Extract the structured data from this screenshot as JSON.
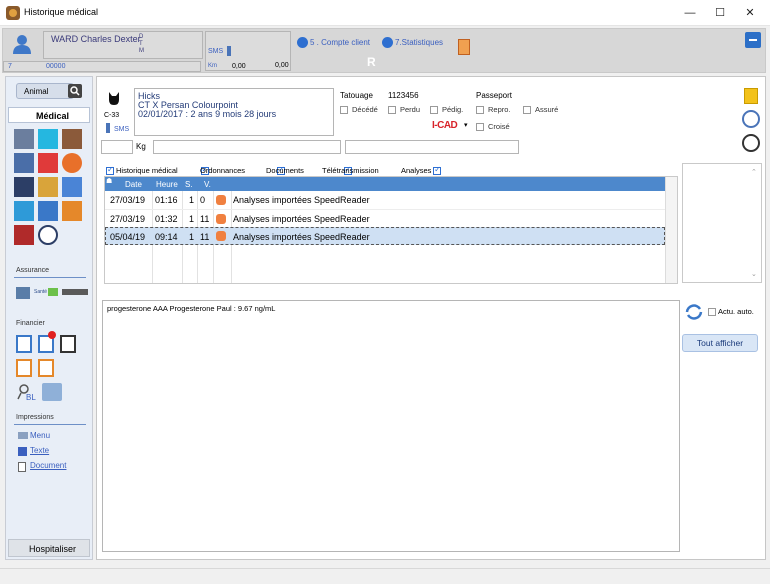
{
  "window": {
    "title": "Historique médical",
    "minimize": "—",
    "maximize": "☐",
    "close": "✕"
  },
  "client": {
    "name": "WARD Charles Dexter",
    "code": "7",
    "number": "00000",
    "flags": [
      "D",
      "T",
      "M"
    ],
    "sms_label": "SMS",
    "km_label": "Km",
    "km_value": "0,00",
    "km_value2": "0,00",
    "account_label": "5 . Compte client",
    "stats_label": "7.Statistiques",
    "r_mark": "R"
  },
  "sidebar": {
    "animal_tab": "Animal",
    "medical_title": "Médical",
    "assurance_title": "Assurance",
    "sante_label": "Santé",
    "financier_title": "Financier",
    "impressions_title": "Impressions",
    "impression_items": [
      "Menu",
      "Texte",
      "Document"
    ],
    "hospitaliser": "Hospitaliser",
    "bl_label": "BL"
  },
  "animal": {
    "name": "Hicks",
    "breed": "CT X Persan Colourpoint",
    "birth": "02/01/2017 : 2 ans 9 mois 28 jours",
    "code": "C-33",
    "sms_label": "SMS",
    "weight_unit": "Kg",
    "tattoo_label": "Tatouage",
    "tattoo_value": "1123456",
    "passport_label": "Passeport",
    "flags": [
      "Décédé",
      "Perdu",
      "Pédig.",
      "Repro.",
      "Assuré"
    ],
    "icad_label": "I-CAD",
    "icad_arrow": "▾",
    "croise_label": "Croisé"
  },
  "filters": [
    "Historique médical",
    "Ordonnances",
    "Documents",
    "Télétransmission",
    "Analyses"
  ],
  "table": {
    "headers": [
      "Date",
      "Heure",
      "S.",
      "V."
    ],
    "rows": [
      {
        "date": "27/03/19",
        "time": "01:16",
        "s": "1",
        "v": "0",
        "label": "Analyses importées SpeedReader"
      },
      {
        "date": "27/03/19",
        "time": "01:32",
        "s": "1",
        "v": "11",
        "label": "Analyses importées SpeedReader"
      },
      {
        "date": "05/04/19",
        "time": "09:14",
        "s": "1",
        "v": "11",
        "label": "Analyses importées SpeedReader"
      }
    ]
  },
  "detail": {
    "text": "progesterone AAA Progesterone Paul :  9.67 ng/mL"
  },
  "actions": {
    "auto_label": "Actu. auto.",
    "show_all": "Tout afficher"
  }
}
